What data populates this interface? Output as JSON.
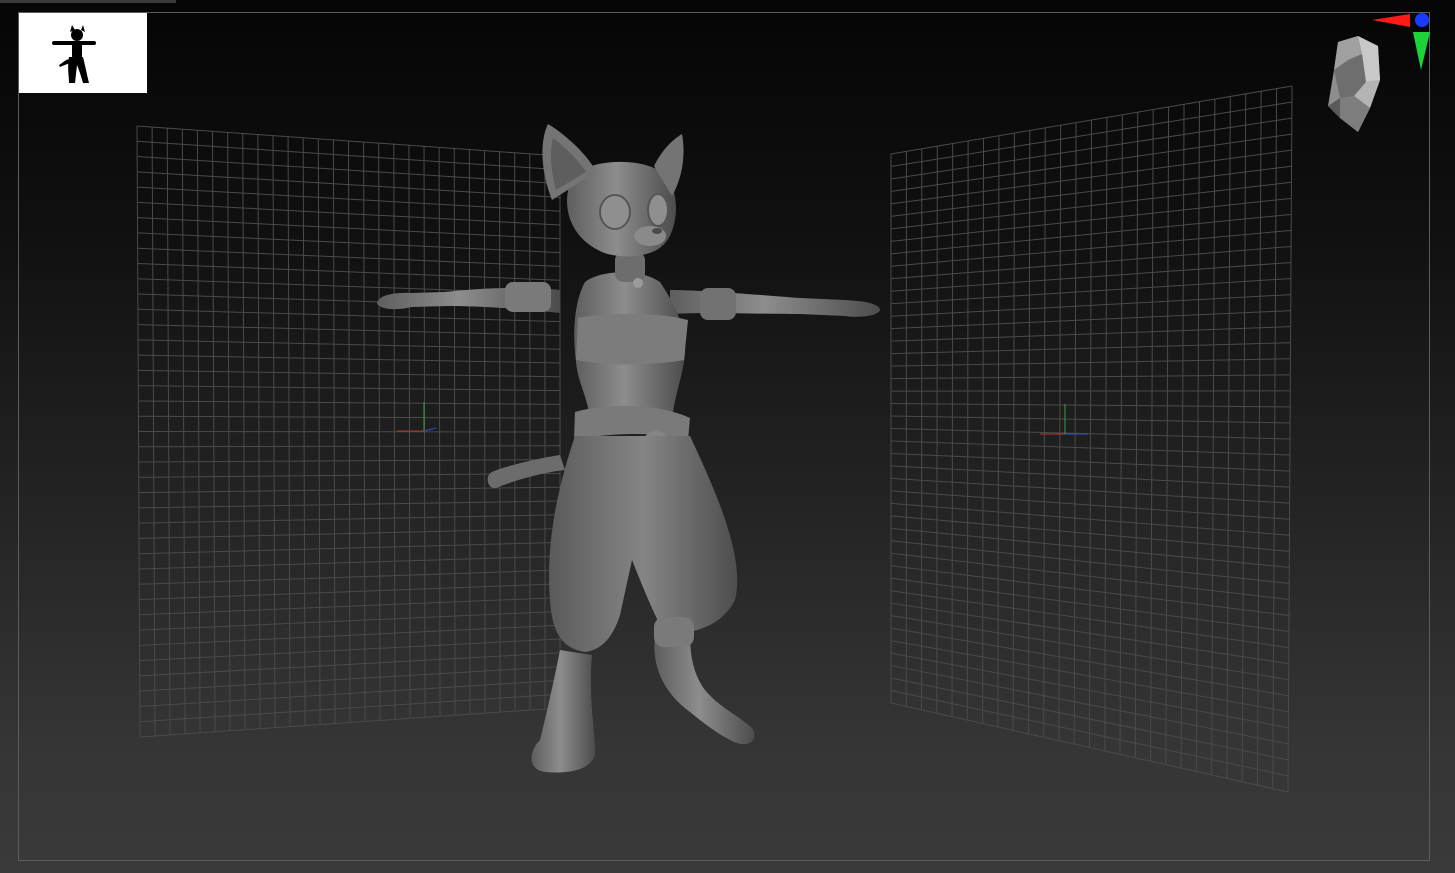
{
  "app": {
    "viewport_background_top": "#050505",
    "viewport_background_bottom": "#3a3a3a",
    "frame_color": "#5c5c5c"
  },
  "thumbnail": {
    "icon": "character-silhouette-icon",
    "background": "#ffffff",
    "silhouette_color": "#000000"
  },
  "scene": {
    "model": "cat-character-model",
    "model_color": "#8a8a8a",
    "grid_color": "#4a4a4a",
    "floor_grids": [
      "left-grid-plane",
      "right-grid-plane"
    ],
    "axis_colors": {
      "x": "#c0302a",
      "y": "#2aa83a",
      "z": "#3050c8"
    }
  },
  "navigation": {
    "head_icon": "navigation-head-icon",
    "axis_x_color": "#ff1a1a",
    "axis_y_color": "#1fd23a",
    "axis_z_color": "#1a3aff"
  }
}
